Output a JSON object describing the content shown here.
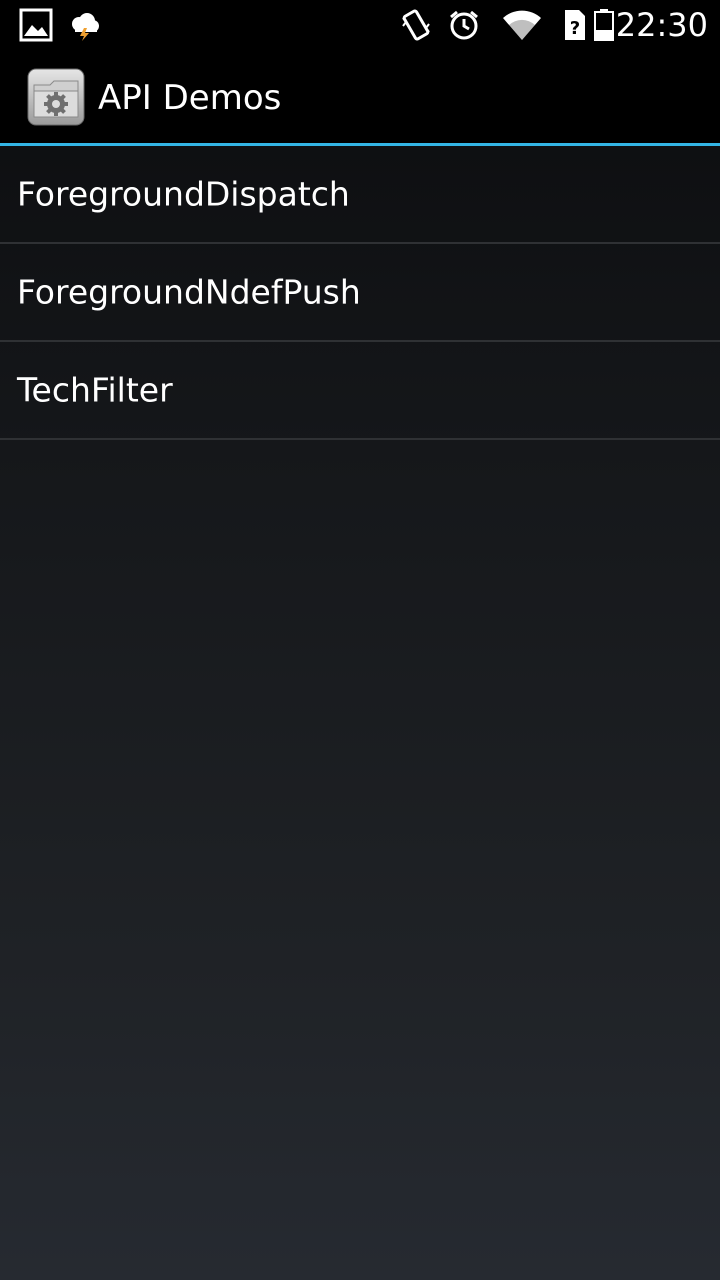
{
  "status_bar": {
    "time": "22:30",
    "icons": [
      "gallery-notification-icon",
      "weather-storm-icon",
      "vibrate-icon",
      "alarm-icon",
      "wifi-icon",
      "no-sim-icon",
      "battery-icon"
    ]
  },
  "action_bar": {
    "title": "API Demos",
    "app_icon": "settings-folder-icon"
  },
  "list": {
    "items": [
      {
        "label": "ForegroundDispatch"
      },
      {
        "label": "ForegroundNdefPush"
      },
      {
        "label": "TechFilter"
      }
    ]
  },
  "colors": {
    "accent": "#33b5e5",
    "divider": "#2f3134",
    "bar_background": "#000000"
  }
}
